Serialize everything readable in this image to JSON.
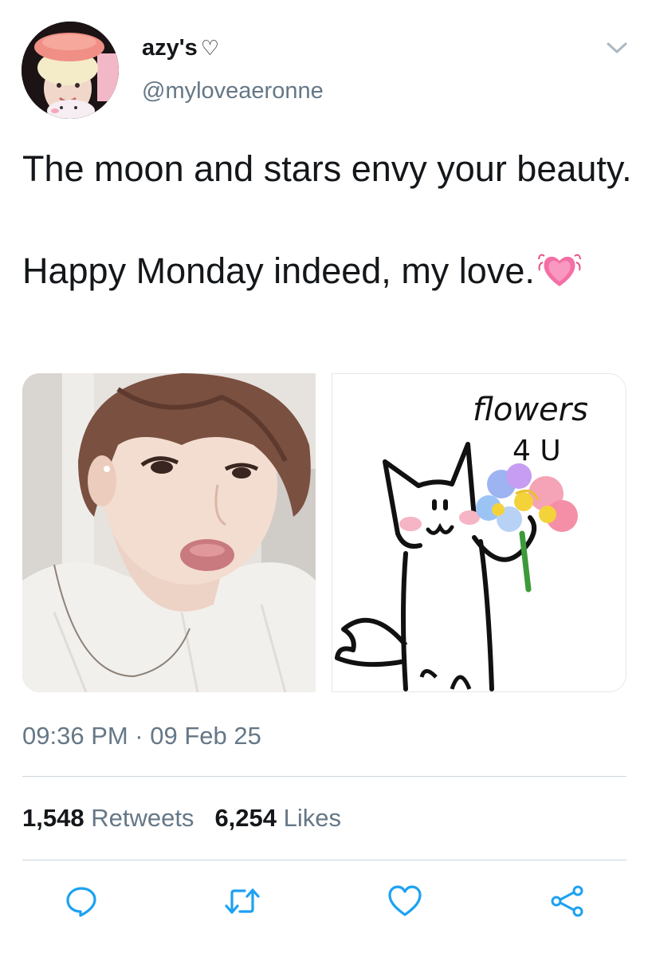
{
  "user": {
    "display_name": "azy's",
    "name_symbol": "♡",
    "handle": "@myloveaeronne"
  },
  "tweet": {
    "line1": "The moon and stars envy your beauty.",
    "line2": "Happy Monday indeed, my love.",
    "emoji": "beating-heart-emoji",
    "timestamp": "09:36 PM · 09 Feb 25"
  },
  "media": {
    "left_image": "selfie-photo",
    "right_image": "cat-drawing",
    "drawing_caption_line1": "flowers",
    "drawing_caption_line2": "4 U"
  },
  "stats": {
    "retweets_count": "1,548",
    "retweets_label": "Retweets",
    "likes_count": "6,254",
    "likes_label": "Likes"
  },
  "actions": [
    "reply-icon",
    "retweet-icon",
    "like-icon",
    "share-icon"
  ],
  "colors": {
    "text": "#14171a",
    "secondary": "#657786",
    "divider": "#ccd6dd",
    "icon": "#1da1f2"
  }
}
